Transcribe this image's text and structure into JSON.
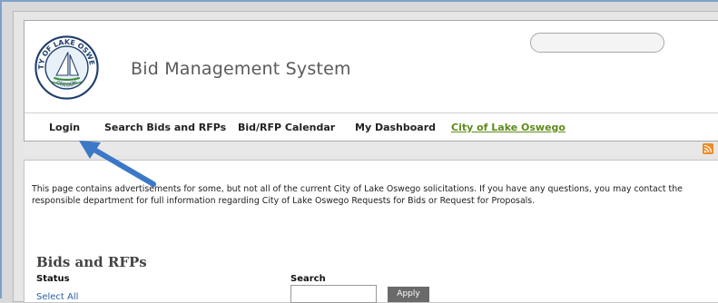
{
  "header": {
    "site_title": "Bid Management System",
    "logo_text_top": "CITY OF LAKE OSWEGO",
    "logo_text_bottom": "OREGON"
  },
  "nav": {
    "items": [
      {
        "label": "Login"
      },
      {
        "label": "Search Bids and RFPs"
      },
      {
        "label": "Bid/RFP Calendar"
      },
      {
        "label": "My Dashboard"
      },
      {
        "label": "City of Lake Oswego"
      }
    ]
  },
  "content": {
    "intro": "This page contains advertisements for some, but not all of the current City of Lake Oswego solicitations. If you have any questions, you may contact the responsible department for full information regarding City of Lake Oswego Requests for Bids or Request for Proposals.",
    "section_title": "Bids and RFPs",
    "status_label": "Status",
    "search_label": "Search",
    "select_all": "Select All",
    "apply_label": "Apply"
  },
  "colors": {
    "nav_link": "#5e8b1c",
    "arrow": "#3b78c7",
    "rss": "#f08a24"
  },
  "icons": {
    "rss": "rss-icon",
    "arrow": "pointer-arrow"
  }
}
